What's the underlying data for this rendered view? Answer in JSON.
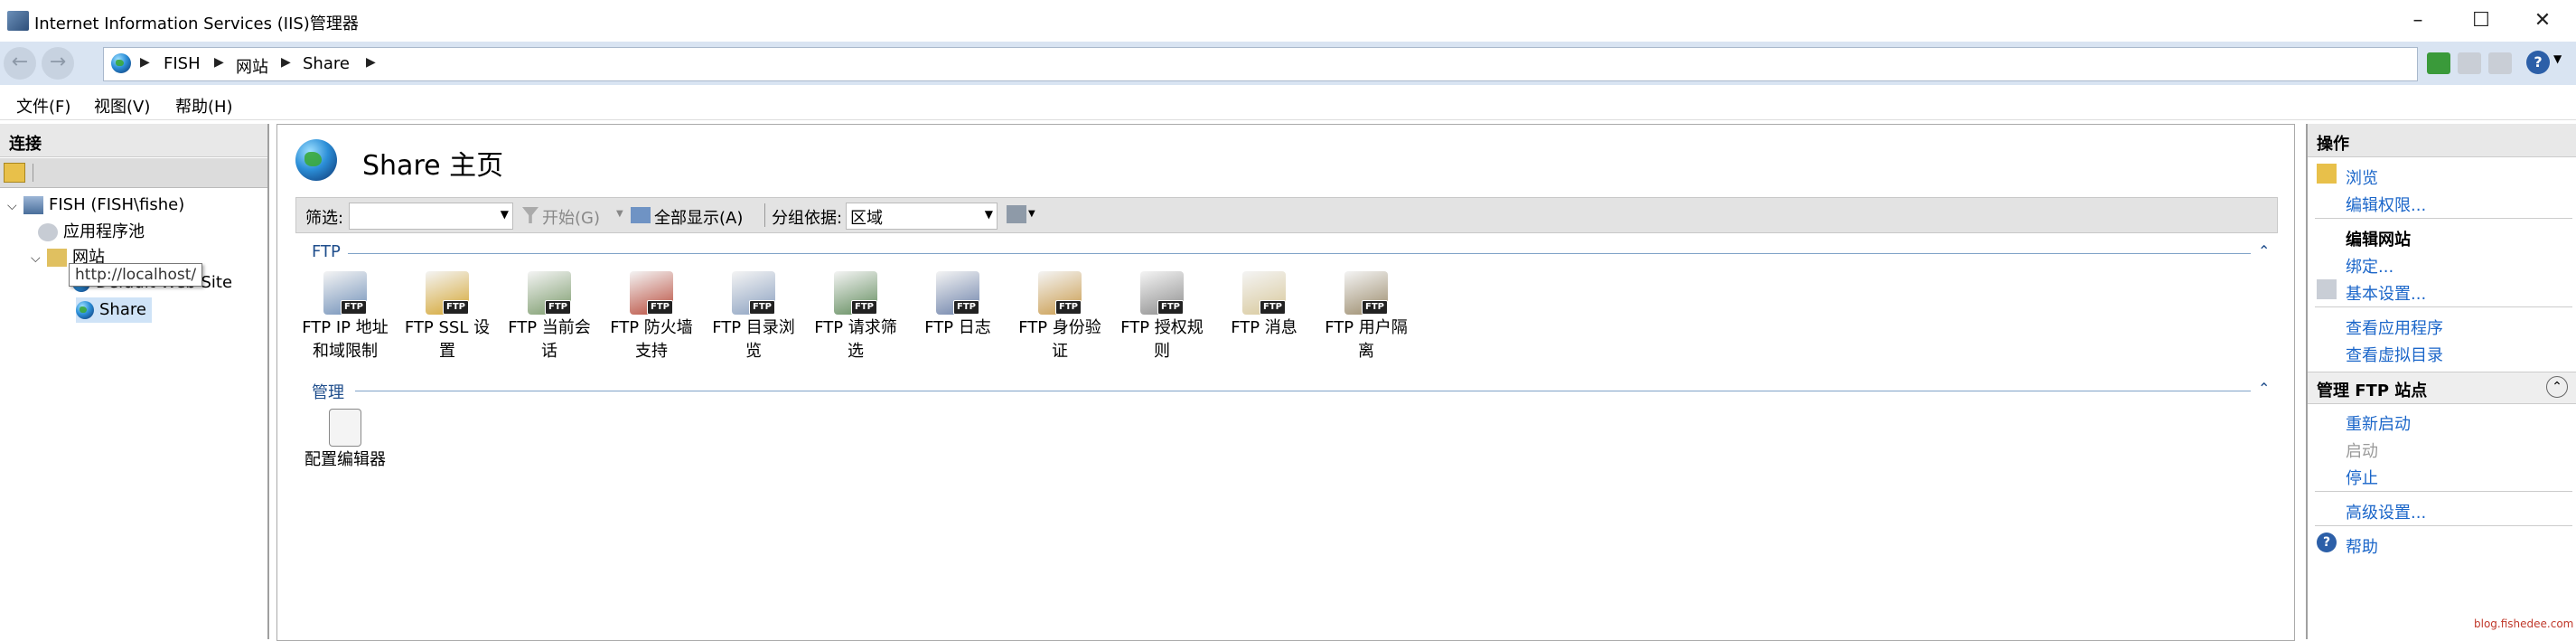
{
  "window": {
    "title": "Internet Information Services (IIS)管理器"
  },
  "addressbar": {
    "crumbs": [
      "FISH",
      "网站",
      "Share"
    ]
  },
  "menu": {
    "items": [
      "文件(F)",
      "视图(V)",
      "帮助(H)"
    ]
  },
  "connections": {
    "header": "连接",
    "tree": {
      "server": "FISH (FISH\\fishe)",
      "app_pools": "应用程序池",
      "sites": "网站",
      "default_site": "Default Web Site",
      "share": "Share"
    },
    "tooltip": "http://localhost/"
  },
  "main": {
    "title": "Share 主页",
    "filter": {
      "label": "筛选:",
      "go": "开始(G)",
      "show_all": "全部显示(A)",
      "group_by_label": "分组依据:",
      "group_by_value": "区域"
    },
    "sections": [
      {
        "label": "FTP",
        "features": [
          {
            "line1": "FTP IP 地址",
            "line2": "和域限制",
            "icon": "ftp-ip-restrictions-icon"
          },
          {
            "line1": "FTP SSL 设",
            "line2": "置",
            "icon": "ftp-ssl-icon"
          },
          {
            "line1": "FTP 当前会",
            "line2": "话",
            "icon": "ftp-sessions-icon"
          },
          {
            "line1": "FTP 防火墙",
            "line2": "支持",
            "icon": "ftp-firewall-icon"
          },
          {
            "line1": "FTP 目录浏",
            "line2": "览",
            "icon": "ftp-directory-browsing-icon"
          },
          {
            "line1": "FTP 请求筛",
            "line2": "选",
            "icon": "ftp-request-filtering-icon"
          },
          {
            "line1": "FTP 日志",
            "line2": "",
            "icon": "ftp-logging-icon"
          },
          {
            "line1": "FTP 身份验",
            "line2": "证",
            "icon": "ftp-authentication-icon"
          },
          {
            "line1": "FTP 授权规",
            "line2": "则",
            "icon": "ftp-authorization-icon"
          },
          {
            "line1": "FTP 消息",
            "line2": "",
            "icon": "ftp-messages-icon"
          },
          {
            "line1": "FTP 用户隔",
            "line2": "离",
            "icon": "ftp-user-isolation-icon"
          }
        ]
      },
      {
        "label": "管理",
        "features": [
          {
            "line1": "配置编辑器",
            "line2": "",
            "icon": "configuration-editor-icon"
          }
        ]
      }
    ]
  },
  "actions": {
    "header": "操作",
    "browse": "浏览",
    "edit_permissions": "编辑权限...",
    "edit_site": "编辑网站",
    "bindings": "绑定...",
    "basic_settings": "基本设置...",
    "view_apps": "查看应用程序",
    "view_vdirs": "查看虚拟目录",
    "manage_ftp": "管理 FTP 站点",
    "restart": "重新启动",
    "start": "启动",
    "stop": "停止",
    "advanced_settings": "高级设置...",
    "help": "帮助"
  },
  "watermark": "blog.fishedee.com"
}
